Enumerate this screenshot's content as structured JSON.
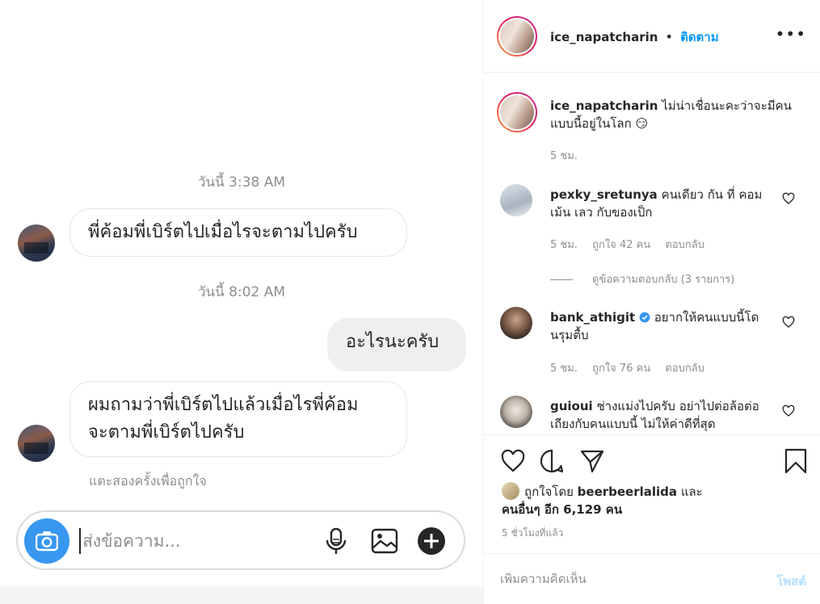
{
  "chat": {
    "timestamp_1": "วันนี้ 3:38 AM",
    "timestamp_2": "วันนี้ 8:02 AM",
    "msg_in_1": "พี่ค้อมพี่เบิร์ตไปเมื่อไรจะตามไปครับ",
    "msg_out_1": "อะไรนะครับ",
    "msg_in_2_line1": "ผมถามว่าพี่เบิร์ตไปแล้วเมื่อไรพี่ค้อม",
    "msg_in_2_line2": "จะตามพี่เบิร์ตไปครับ",
    "double_tap_hint": "แตะสองครั้งเพื่อถูกใจ",
    "composer_placeholder": "ส่งข้อความ..."
  },
  "post": {
    "header": {
      "username": "ice_napatcharin",
      "separator": "•",
      "follow_label": "ติดตาม",
      "more_label": "•••"
    },
    "caption": {
      "username": "ice_napatcharin",
      "text": "ไม่น่าเชื่อนะคะว่าจะมีคนแบบนี้อยู่ในโลก 😏",
      "time": "5 ชม."
    },
    "comments": [
      {
        "username": "pexky_sretunya",
        "text": "คนเดียว กัน ที่ คอมเม้น เลว กับของเป็ก",
        "time": "5 ชม.",
        "likes": "ถูกใจ 42 คน",
        "reply": "ตอบกลับ",
        "view_replies": "ดูข้อความตอบกลับ (3 รายการ)"
      },
      {
        "username": "bank_athigit",
        "text": "อยากให้คนแบบนี้โดนรุมตื้บ",
        "time": "5 ชม.",
        "likes": "ถูกใจ 76 คน",
        "reply": "ตอบกลับ"
      },
      {
        "username": "guioui",
        "text": "ช่างแม่งไปครับ อย่าไปต่อล้อต่อเถียงกับคนแบบนี้ ไม่ให้ค่าดีที่สุด"
      }
    ],
    "liked_by_prefix": "ถูกใจโดย",
    "liked_by_user": "beerbeerlalida",
    "liked_by_and": "และ",
    "liked_by_others": "คนอื่นๆ อีก 6,129 คน",
    "time_ago": "5 ชั่วโมงที่แล้ว",
    "add_comment_placeholder": "เพิ่มความคิดเห็น",
    "post_label": "โพสต์"
  },
  "colors": {
    "accent_blue": "#0095f6",
    "camera_blue": "#3897f0",
    "verified_blue": "#3897f0",
    "muted_text": "#8e8e8e"
  }
}
